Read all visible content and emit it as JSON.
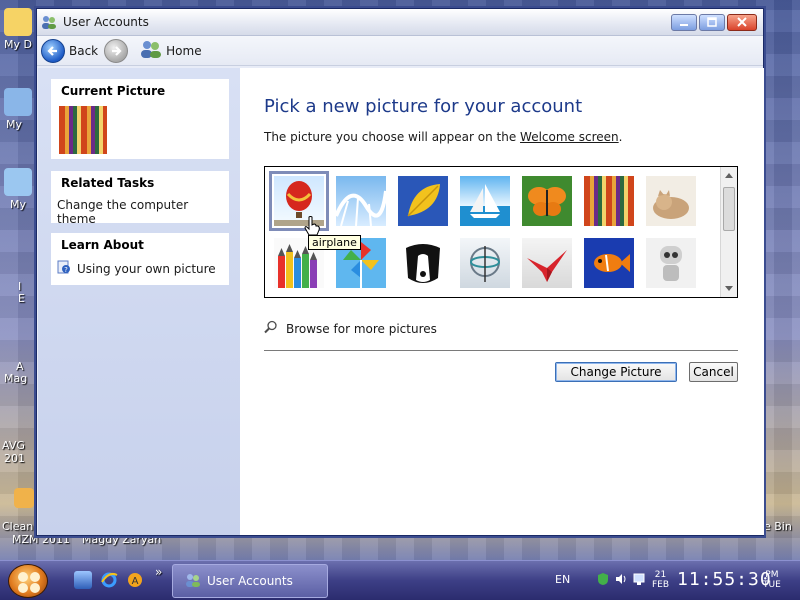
{
  "desktop": {
    "labels": [
      "My D",
      "My",
      "My",
      "I",
      "E",
      "A",
      "Mag",
      "AVG",
      "201",
      "Clean",
      "MZM 2011",
      "Magdy Zaryan",
      "e Bin"
    ]
  },
  "window": {
    "title": "User Accounts",
    "toolbar": {
      "back_label": "Back",
      "home_label": "Home"
    },
    "left": {
      "current_picture_heading": "Current Picture",
      "related_tasks_heading": "Related Tasks",
      "related_tasks_items": [
        "Change the computer theme"
      ],
      "learn_about_heading": "Learn About",
      "learn_about_items": [
        "Using your own picture"
      ]
    },
    "main": {
      "heading": "Pick a new picture for your account",
      "subtext_prefix": "The picture you choose will appear on the ",
      "subtext_link": "Welcome screen",
      "subtext_suffix": ".",
      "tooltip": "airplane",
      "browse_label": "Browse for more pictures",
      "change_button": "Change Picture",
      "cancel_button": "Cancel"
    }
  },
  "taskbar": {
    "task_button_label": "User Accounts",
    "chevron": "»",
    "language": "EN",
    "date_day": "21",
    "date_month": "FEB",
    "time": "11:55:30",
    "ampm": "PM",
    "weekday": "TUE"
  },
  "colors": {
    "heading": "#1d3a8a",
    "taskbar": "#3d3f86",
    "window_border": "#1b2a66"
  }
}
